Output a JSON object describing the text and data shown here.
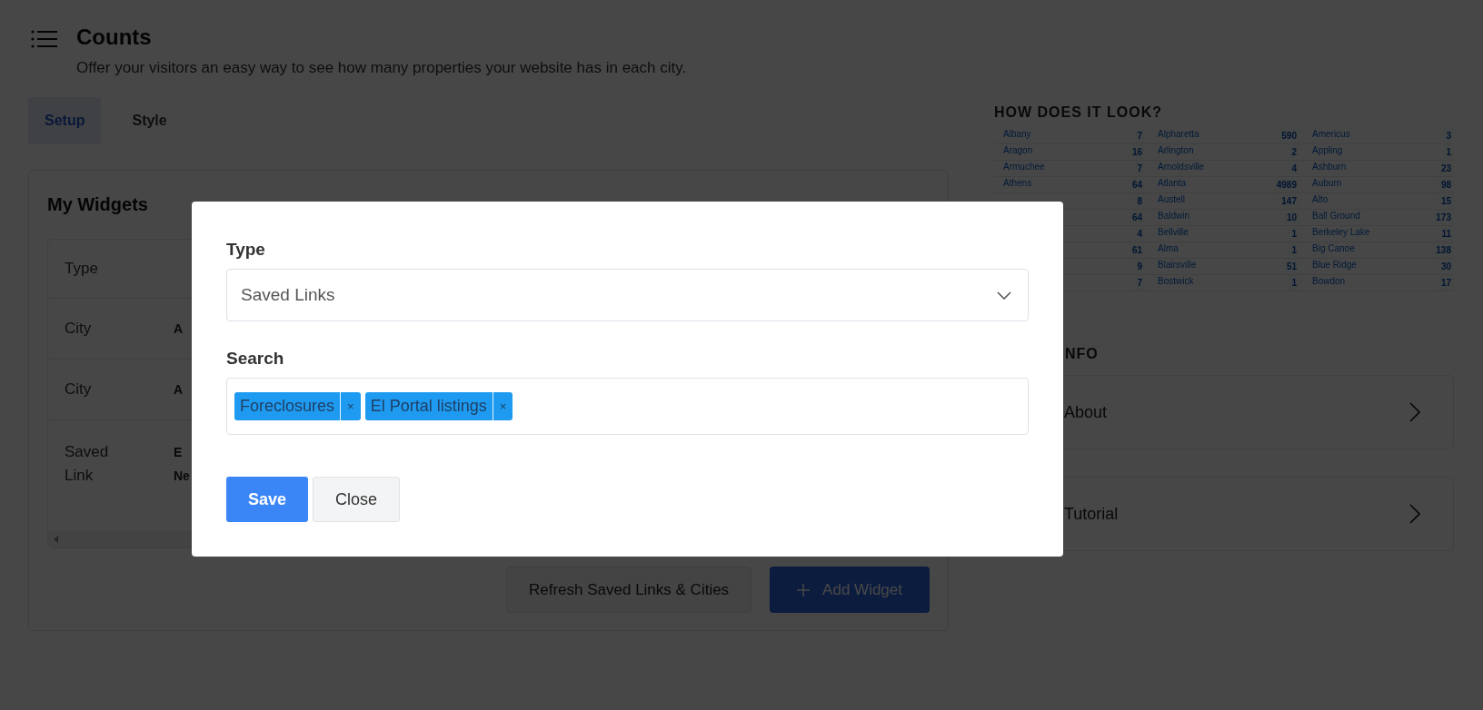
{
  "header": {
    "title": "Counts",
    "subtitle": "Offer your visitors an easy way to see how many properties your website has in each city."
  },
  "tabs": [
    {
      "label": "Setup",
      "selected": true
    },
    {
      "label": "Style",
      "selected": false
    }
  ],
  "widgets_card": {
    "title": "My Widgets",
    "header": "Type",
    "rows": [
      {
        "type": "City",
        "column_2": [
          "A"
        ]
      },
      {
        "type": "City",
        "column_2": [
          "A"
        ]
      },
      {
        "type": "Saved Link",
        "column_2": [
          "E",
          "Ne"
        ]
      }
    ],
    "buttons": [
      {
        "label": "Refresh Saved Links & Cities",
        "kind": "secondary"
      },
      {
        "label": "Add Widget",
        "kind": "primary"
      }
    ]
  },
  "preview": {
    "heading": "HOW DOES IT LOOK?",
    "rows": [
      [
        {
          "name": "Albany",
          "count": "7"
        },
        {
          "name": "Alpharetta",
          "count": "590"
        },
        {
          "name": "Americus",
          "count": "3"
        }
      ],
      [
        {
          "name": "Aragon",
          "count": "16"
        },
        {
          "name": "Arlington",
          "count": "2"
        },
        {
          "name": "Appling",
          "count": "1"
        }
      ],
      [
        {
          "name": "Armuchee",
          "count": "7"
        },
        {
          "name": "Arnoldsville",
          "count": "4"
        },
        {
          "name": "Ashburn",
          "count": "23"
        }
      ],
      [
        {
          "name": "Athens",
          "count": "64"
        },
        {
          "name": "Atlanta",
          "count": "4989"
        },
        {
          "name": "Auburn",
          "count": "98"
        }
      ],
      [
        {
          "count": "8"
        },
        {
          "name": "Austell",
          "count": "147"
        },
        {
          "name": "Alto",
          "count": "15"
        }
      ],
      [
        {
          "count": "64"
        },
        {
          "name": "Baldwin",
          "count": "10"
        },
        {
          "name": "Ball Ground",
          "count": "173"
        }
      ],
      [
        {
          "count": "4"
        },
        {
          "name": "Bellville",
          "count": "1"
        },
        {
          "name": "Berkeley Lake",
          "count": "11"
        }
      ],
      [
        {
          "count": "61"
        },
        {
          "name": "Alma",
          "count": "1"
        },
        {
          "name": "Big Canoe",
          "count": "138"
        }
      ],
      [
        {
          "count": "9"
        },
        {
          "name": "Blairsville",
          "count": "51"
        },
        {
          "name": "Blue Ridge",
          "count": "30"
        }
      ],
      [
        {
          "count": "7"
        },
        {
          "name": "Bostwick",
          "count": "1"
        },
        {
          "name": "Bowdon",
          "count": "17"
        }
      ]
    ]
  },
  "info": {
    "heading": "NFO",
    "items": [
      {
        "label": "About"
      },
      {
        "label": "Tutorial"
      }
    ]
  },
  "modal": {
    "type_label": "Type",
    "type_value": "Saved Links",
    "search_label": "Search",
    "tags": [
      {
        "label": "Foreclosures",
        "remove": "×"
      },
      {
        "label": "El Portal listings",
        "remove": "×"
      }
    ],
    "buttons": [
      {
        "label": "Save",
        "kind": "primary"
      },
      {
        "label": "Close",
        "kind": "secondary"
      }
    ]
  }
}
